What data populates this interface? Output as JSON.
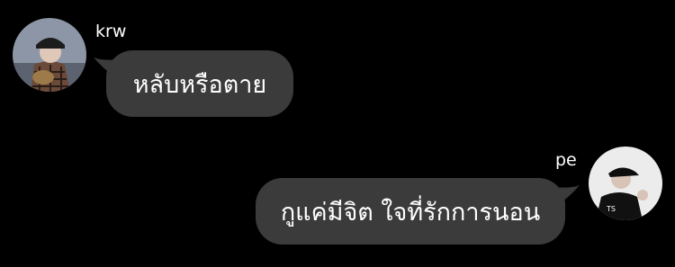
{
  "messages": [
    {
      "sender": "krw",
      "side": "left",
      "text": "หลับหรือตาย",
      "avatar": "user-avatar-krw"
    },
    {
      "sender": "pe",
      "side": "right",
      "text": "กูแค่มีจิต ใจที่รักการนอน",
      "avatar": "user-avatar-pe"
    }
  ],
  "colors": {
    "background": "#000000",
    "bubble": "#3b3b3b",
    "text": "#ffffff"
  }
}
